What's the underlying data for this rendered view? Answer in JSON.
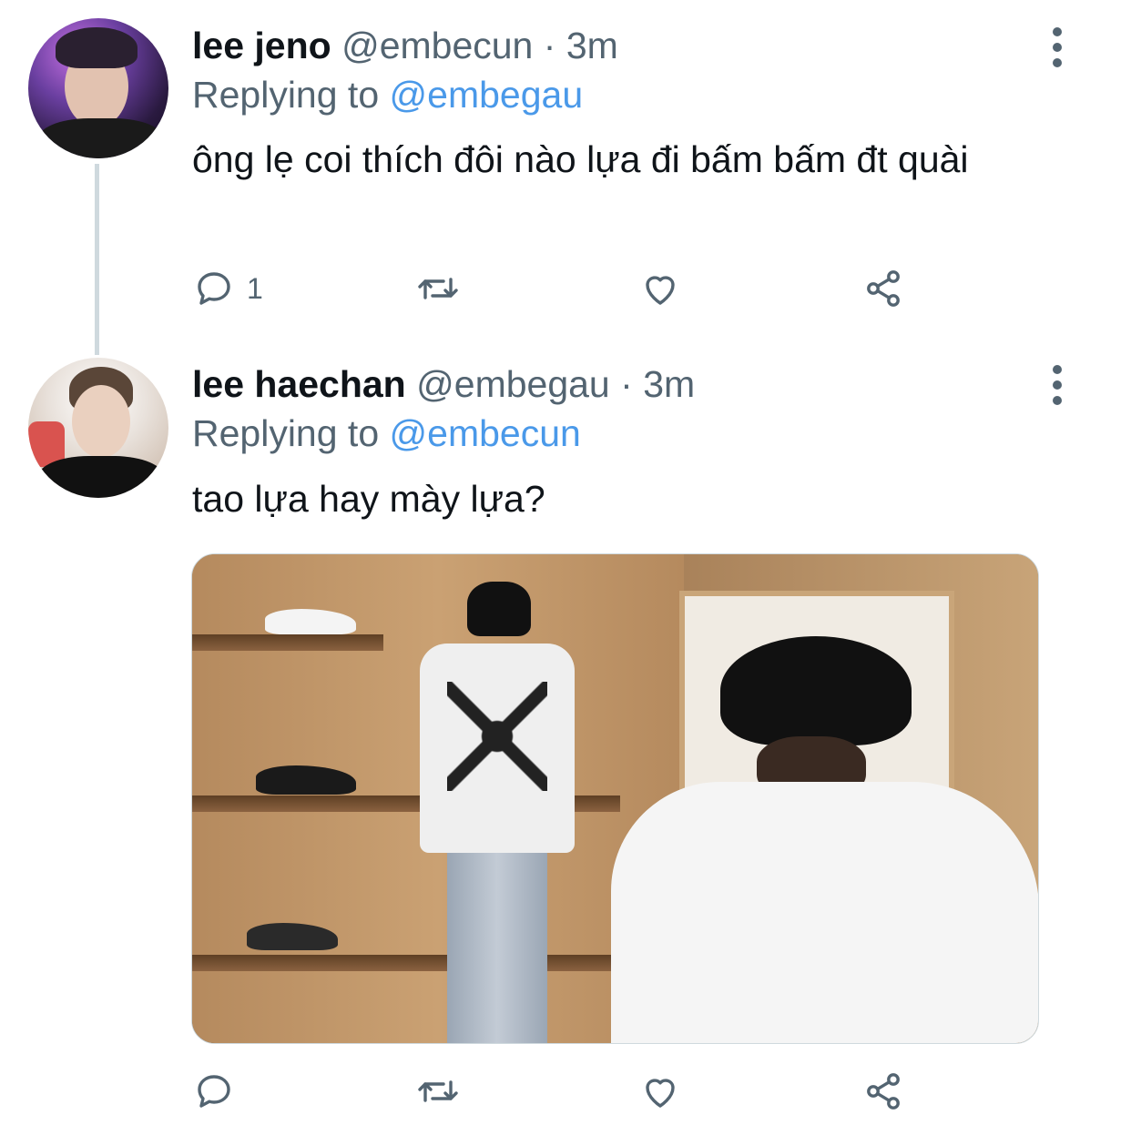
{
  "tweets": [
    {
      "name": "lee jeno",
      "handle": "@embecun",
      "separator": "·",
      "time": "3m",
      "replying_prefix": "Replying to",
      "replying_handle": "@embegau",
      "text": "ông lẹ coi thích đôi nào lựa đi bấm bấm đt quài",
      "reply_count": "1"
    },
    {
      "name": "lee haechan",
      "handle": "@embegau",
      "separator": "·",
      "time": "3m",
      "replying_prefix": "Replying to",
      "replying_handle": "@embecun",
      "text": "tao lựa hay mày lựa?",
      "reply_count": ""
    }
  ],
  "icons": {
    "reply": "reply-icon",
    "retweet": "retweet-icon",
    "like": "heart-icon",
    "share": "share-icon",
    "more": "more-vertical-icon"
  },
  "colors": {
    "link": "#4a99e9",
    "secondary_text": "#536471",
    "primary_text": "#0f1419",
    "thread_line": "#cfd9de"
  }
}
